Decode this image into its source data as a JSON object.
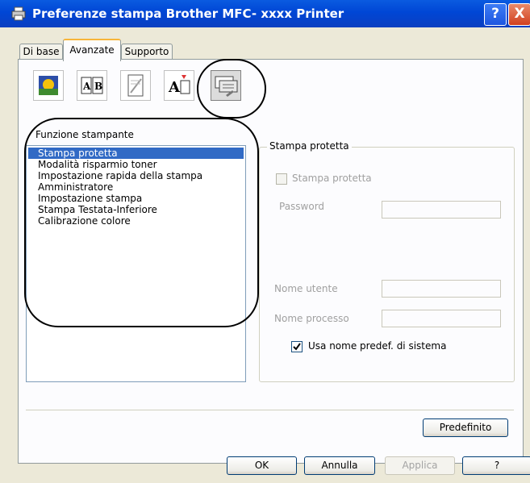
{
  "window": {
    "title": "Preferenze stampa Brother MFC-  xxxx  Printer",
    "help_label": "?",
    "close_label": "X"
  },
  "tabs": [
    {
      "label": "Di base"
    },
    {
      "label": "Avanzate"
    },
    {
      "label": "Supporto"
    }
  ],
  "toolbar_icons": [
    "color-icon",
    "duplex-icon",
    "watermark-icon",
    "scaling-icon",
    "device-options-icon"
  ],
  "printer_functions": {
    "label": "Funzione stampante",
    "items": [
      "Stampa protetta",
      "Modalità risparmio toner",
      "Impostazione rapida della stampa",
      "Amministratore",
      "Impostazione stampa",
      "Stampa Testata-Inferiore",
      "Calibrazione colore"
    ],
    "selected_index": 0
  },
  "secure_print": {
    "group_label": "Stampa protetta",
    "checkbox_label": "Stampa protetta",
    "checkbox_checked": false,
    "password_label": "Password",
    "password_value": "",
    "user_name_label": "Nome utente",
    "user_name_value": "",
    "job_name_label": "Nome processo",
    "job_name_value": "",
    "use_default_label": "Usa nome predef. di sistema",
    "use_default_checked": true
  },
  "buttons": {
    "default": "Predefinito",
    "ok": "OK",
    "cancel": "Annulla",
    "apply": "Applica",
    "help": "?"
  },
  "colors": {
    "title_bar": "#0046d5",
    "selection": "#316ac5",
    "tab_highlight": "#f8b53a",
    "dialog_bg": "#ece9d8"
  }
}
